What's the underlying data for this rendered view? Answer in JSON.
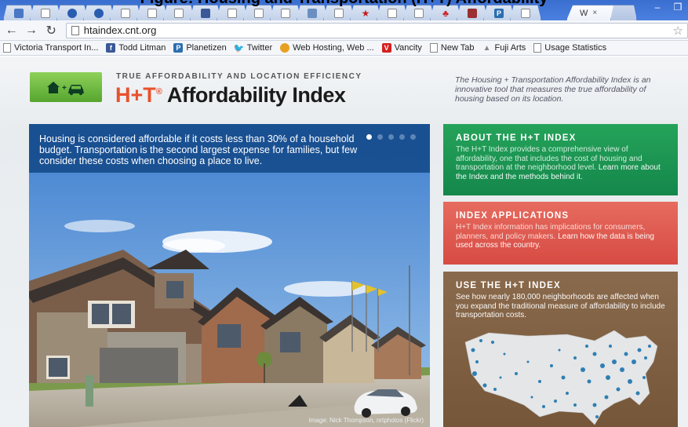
{
  "figure_title": "Figure: Housing and Transportation (H+T) Affordability",
  "browser": {
    "active_tab_label": "W",
    "active_tab_close": "×",
    "url": "htaindex.cnt.org",
    "bookmarks": [
      {
        "label": "Victoria Transport In...",
        "icon": "page-icon"
      },
      {
        "label": "Todd Litman",
        "icon": "facebook-icon"
      },
      {
        "label": "Planetizen",
        "icon": "planetizen-icon"
      },
      {
        "label": "Twitter",
        "icon": "twitter-icon"
      },
      {
        "label": "Web Hosting, Web ...",
        "icon": "hosting-icon"
      },
      {
        "label": "Vancity",
        "icon": "vancity-icon"
      },
      {
        "label": "New Tab",
        "icon": "page-icon"
      },
      {
        "label": "Fuji Arts",
        "icon": "fuji-icon"
      },
      {
        "label": "Usage Statistics",
        "icon": "page-icon"
      }
    ]
  },
  "header": {
    "tagline": "TRUE AFFORDABILITY AND LOCATION EFFICIENCY",
    "brand_ht": "H+T",
    "brand_reg": "®",
    "brand_name": " Affordability Index",
    "description": "The Housing + Transportation Affordability Index is an innovative tool that measures the true affordability of housing based on its location."
  },
  "hero": {
    "banner_text": "Housing is considered affordable if it costs less than 30% of a household budget. Transportation is the second largest expense for families, but few consider these costs when choosing a place to live.",
    "credit": "Image: Nick Thompson, nrtphotos (Flickr)",
    "slide_count": 5,
    "active_slide": 1
  },
  "panels": {
    "about": {
      "title": "ABOUT THE H+T INDEX",
      "body": "The H+T Index provides a comprehensive view of affordability, one that includes the cost of housing and transportation at the neighborhood level.",
      "link": "Learn more about the Index and the methods behind it."
    },
    "apps": {
      "title": "INDEX APPLICATIONS",
      "body": "H+T Index information has implications for consumers, planners, and policy makers.",
      "link": "Learn how the data is being used across the country."
    },
    "use": {
      "title": "USE THE H+T INDEX",
      "body": "See how nearly 180,000 neighborhoods are affected when you expand the traditional measure of affordability to include transportation costs."
    }
  },
  "colors": {
    "about_green": "#1c9a55",
    "apps_red": "#e05a50",
    "use_brown": "#7f5f43",
    "brand_orange": "#e8512d"
  }
}
